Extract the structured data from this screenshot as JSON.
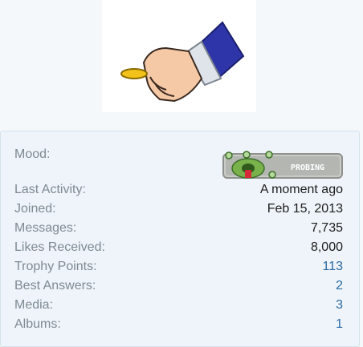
{
  "profile": {
    "avatar_icon": "hand-holding-coin-icon",
    "mood": {
      "label": "Mood:",
      "badge_text": "PROBING",
      "icon": "alien-eyes-icon"
    },
    "stats": [
      {
        "label": "Last Activity:",
        "value": "A moment ago",
        "link": false
      },
      {
        "label": "Joined:",
        "value": "Feb 15, 2013",
        "link": false
      },
      {
        "label": "Messages:",
        "value": "7,735",
        "link": false
      },
      {
        "label": "Likes Received:",
        "value": "8,000",
        "link": false
      },
      {
        "label": "Trophy Points:",
        "value": "113",
        "link": true
      },
      {
        "label": "Best Answers:",
        "value": "2",
        "link": true
      },
      {
        "label": "Media:",
        "value": "3",
        "link": true
      },
      {
        "label": "Albums:",
        "value": "1",
        "link": true
      }
    ]
  },
  "colors": {
    "link": "#2b6aa5",
    "label": "#808a93",
    "panel_bg": "#eef4f9"
  }
}
